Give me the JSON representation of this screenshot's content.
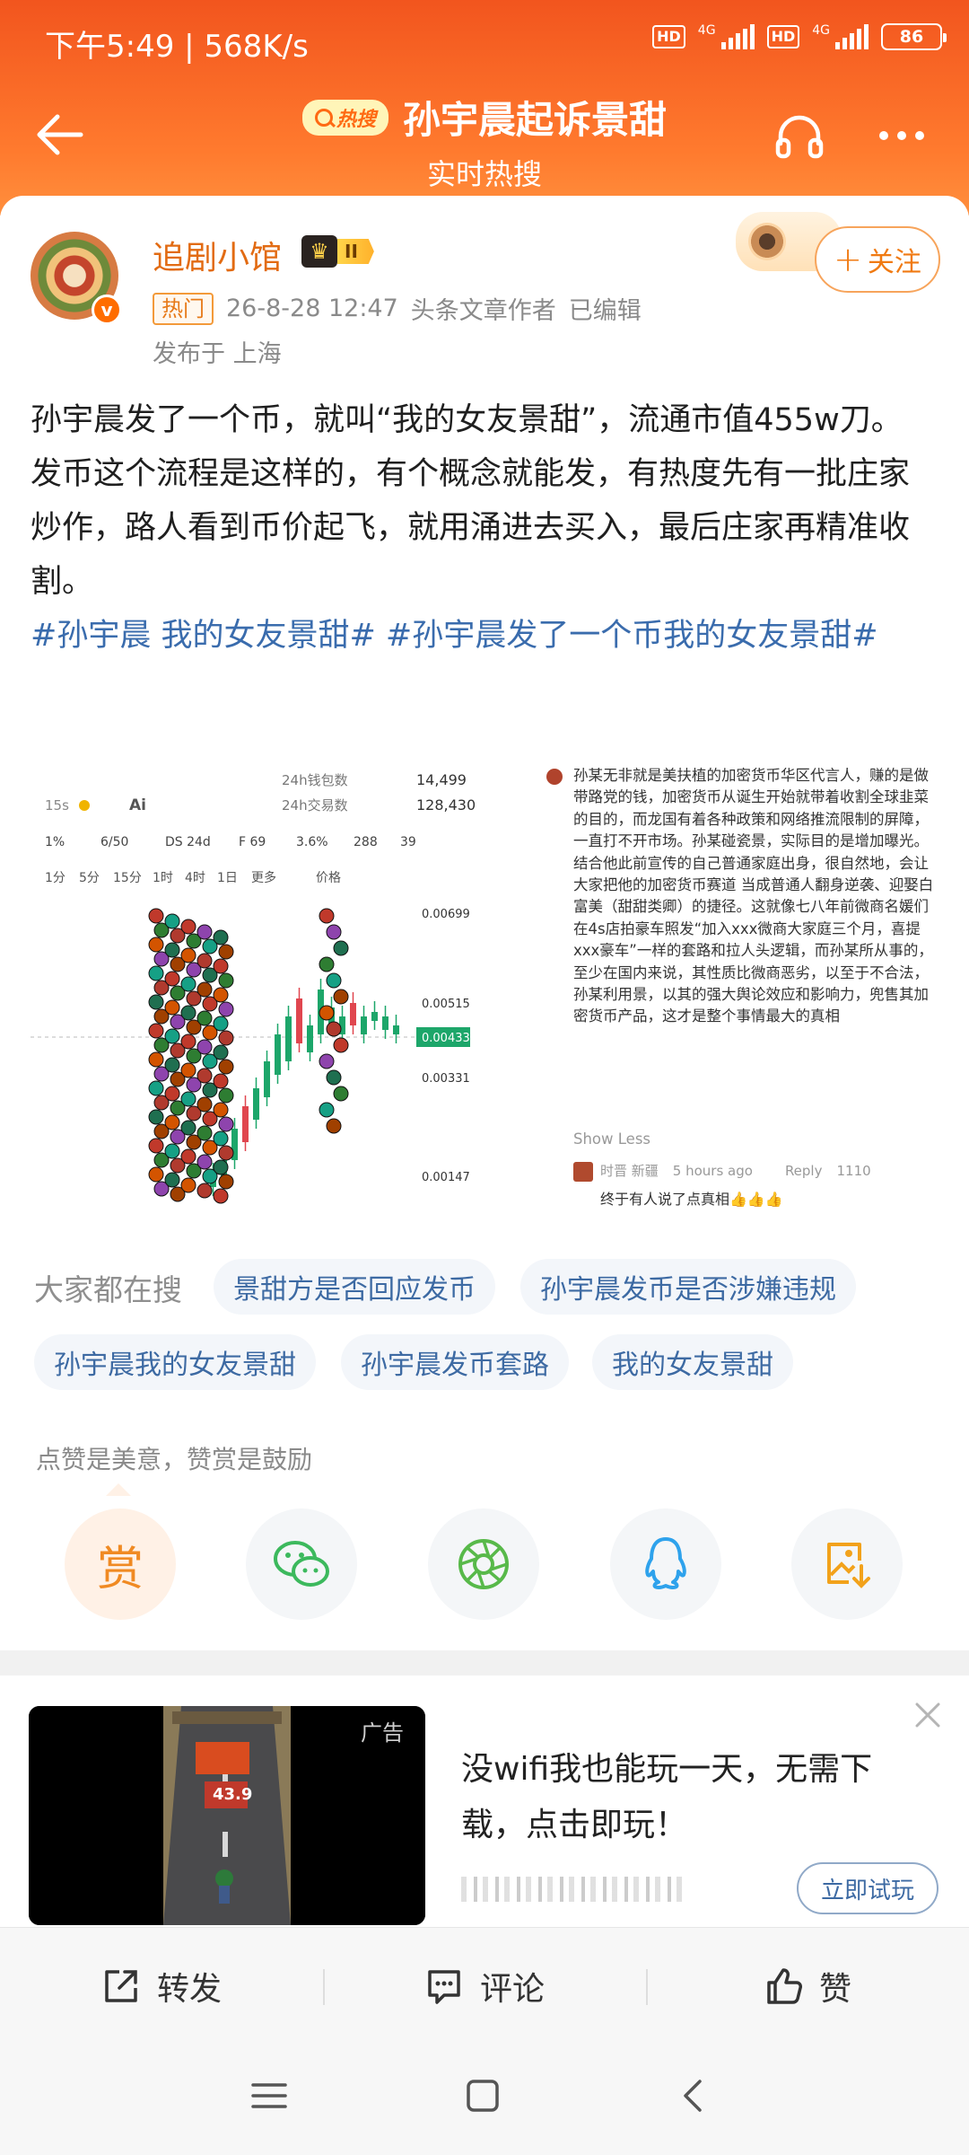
{
  "status": {
    "time_speed": "下午5:49 | 568K/s",
    "hd1": "HD",
    "net1": "4G",
    "hd2": "HD",
    "net2": "4G",
    "battery": "86"
  },
  "header": {
    "hot_logo": "热搜",
    "title": "孙宇晨起诉景甜",
    "subtitle": "实时热搜"
  },
  "post": {
    "author": "追剧小馆",
    "level": "II",
    "hot_tag": "热门",
    "datetime": "26-8-28 12:47",
    "author_role": "头条文章作者",
    "edited": "已编辑",
    "location": "发布于 上海",
    "follow_label": "关注",
    "paragraph1": "孙宇晨发了一个币，就叫“我的女友景甜”，流通市值455w刀。",
    "paragraph2": "发币这个流程是这样的，有个概念就能发，有热度先有一批庄家炒作，路人看到币价起飞，就用涌进去买入，最后庄家再精准收割。",
    "hashtag1": "#孙宇晨 我的女友景甜#",
    "hashtag2": "#孙宇晨发了一个币我的女友景甜#"
  },
  "image": {
    "stat1_label": "24h钱包数",
    "stat1_value": "14,499",
    "stat2_label": "24h交易数",
    "stat2_value": "128,430",
    "interval": "15s",
    "ai_label": "Ai",
    "metrics": [
      "1%",
      "6/50",
      "DS 24d",
      "F 69",
      "3.6%",
      "288",
      "39"
    ],
    "timeframes": [
      "1分",
      "5分",
      "15分",
      "1时",
      "4时",
      "1日",
      "更多",
      "价格"
    ],
    "y_ticks": [
      "0.00699",
      "0.00515",
      "0.00433",
      "0.00331",
      "0.00147"
    ],
    "comment": "孙某无非就是美扶植的加密货币华区代言人，赚的是做带路党的钱，加密货币从诞生开始就带着收割全球韭菜的目的，而龙国有着各种政策和网络推流限制的屏障，一直打不开市场。孙某碰瓷景，实际目的是增加曝光。结合他此前宣传的自己普通家庭出身，很自然地，会让大家把他的加密货币赛道 当成普通人翻身逆袭、迎娶白富美（甜甜类卿）的捷径。这就像七八年前微商名媛们在4s店拍豪车照发“加入xxx微商大家庭三个月，喜提xxx豪车”一样的套路和拉人头逻辑，而孙某所从事的，至少在国内来说，其性质比微商恶劣，以至于不合法，孙某利用景，以其的强大舆论效应和影响力，兜售其加密货币产品，这才是整个事情最大的真相",
    "show_less": "Show Less",
    "reply_name": "时晋 新疆",
    "reply_time": "5 hours ago",
    "reply_btn": "Reply",
    "reply_likes": "1110",
    "reply_text": "终于有人说了点真相👍👍👍"
  },
  "related": {
    "label": "大家都在搜",
    "chips": [
      "景甜方是否回应发币",
      "孙宇晨发币是否涉嫌违规",
      "孙宇晨我的女友景甜",
      "孙宇晨发币套路",
      "我的女友景甜"
    ]
  },
  "reward": {
    "tip": "点赞是美意，赞赏是鼓励",
    "reward_label": "赏"
  },
  "ad": {
    "label": "广告",
    "headline": "没wifi我也能玩一天，无需下载，点击即玩！",
    "cta": "立即试玩",
    "game_text": "43.9"
  },
  "actions": {
    "repost": "转发",
    "comment": "评论",
    "like": "赞"
  },
  "colors": {
    "header": "#f2551e",
    "accent": "#f07a12",
    "link": "#3a6cad"
  }
}
